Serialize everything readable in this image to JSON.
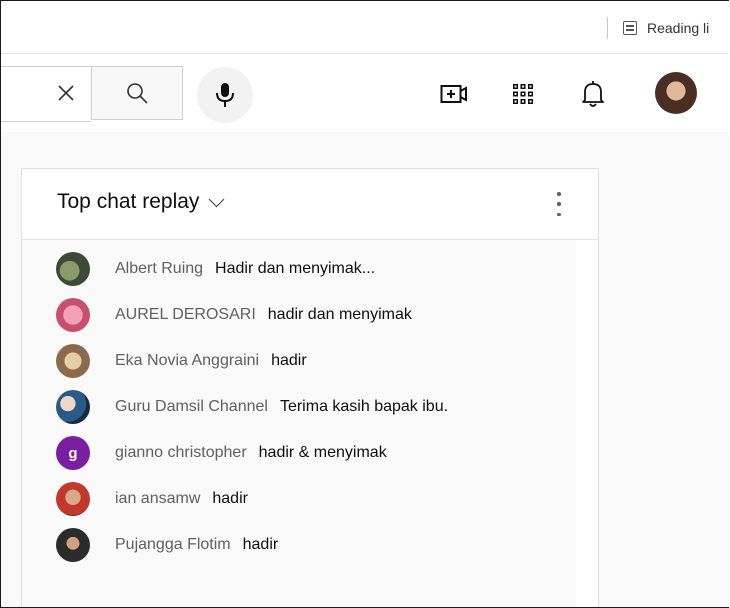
{
  "browser": {
    "reading_list_label": "Reading li"
  },
  "colors": {
    "accent_purple": "#7b1fa2",
    "author_gray": "#606060",
    "text_dark": "#0f0f0f"
  },
  "topbar": {
    "icons": [
      "close-icon",
      "search-icon",
      "mic-icon",
      "create-video-icon",
      "apps-grid-icon",
      "bell-icon"
    ]
  },
  "chat": {
    "title": "Top chat replay",
    "messages": [
      {
        "author": "Albert Ruing",
        "text": "Hadir dan menyimak..."
      },
      {
        "author": "AUREL DEROSARI",
        "text": "hadir dan menyimak"
      },
      {
        "author": "Eka Novia Anggraini",
        "text": "hadir"
      },
      {
        "author": "Guru Damsil Channel",
        "text": "Terima kasih bapak ibu."
      },
      {
        "author": "gianno christopher",
        "text": "hadir & menyimak",
        "avatar_letter": "g"
      },
      {
        "author": "ian ansamw",
        "text": "hadir"
      },
      {
        "author": "Pujangga Flotim",
        "text": "hadir"
      }
    ]
  }
}
